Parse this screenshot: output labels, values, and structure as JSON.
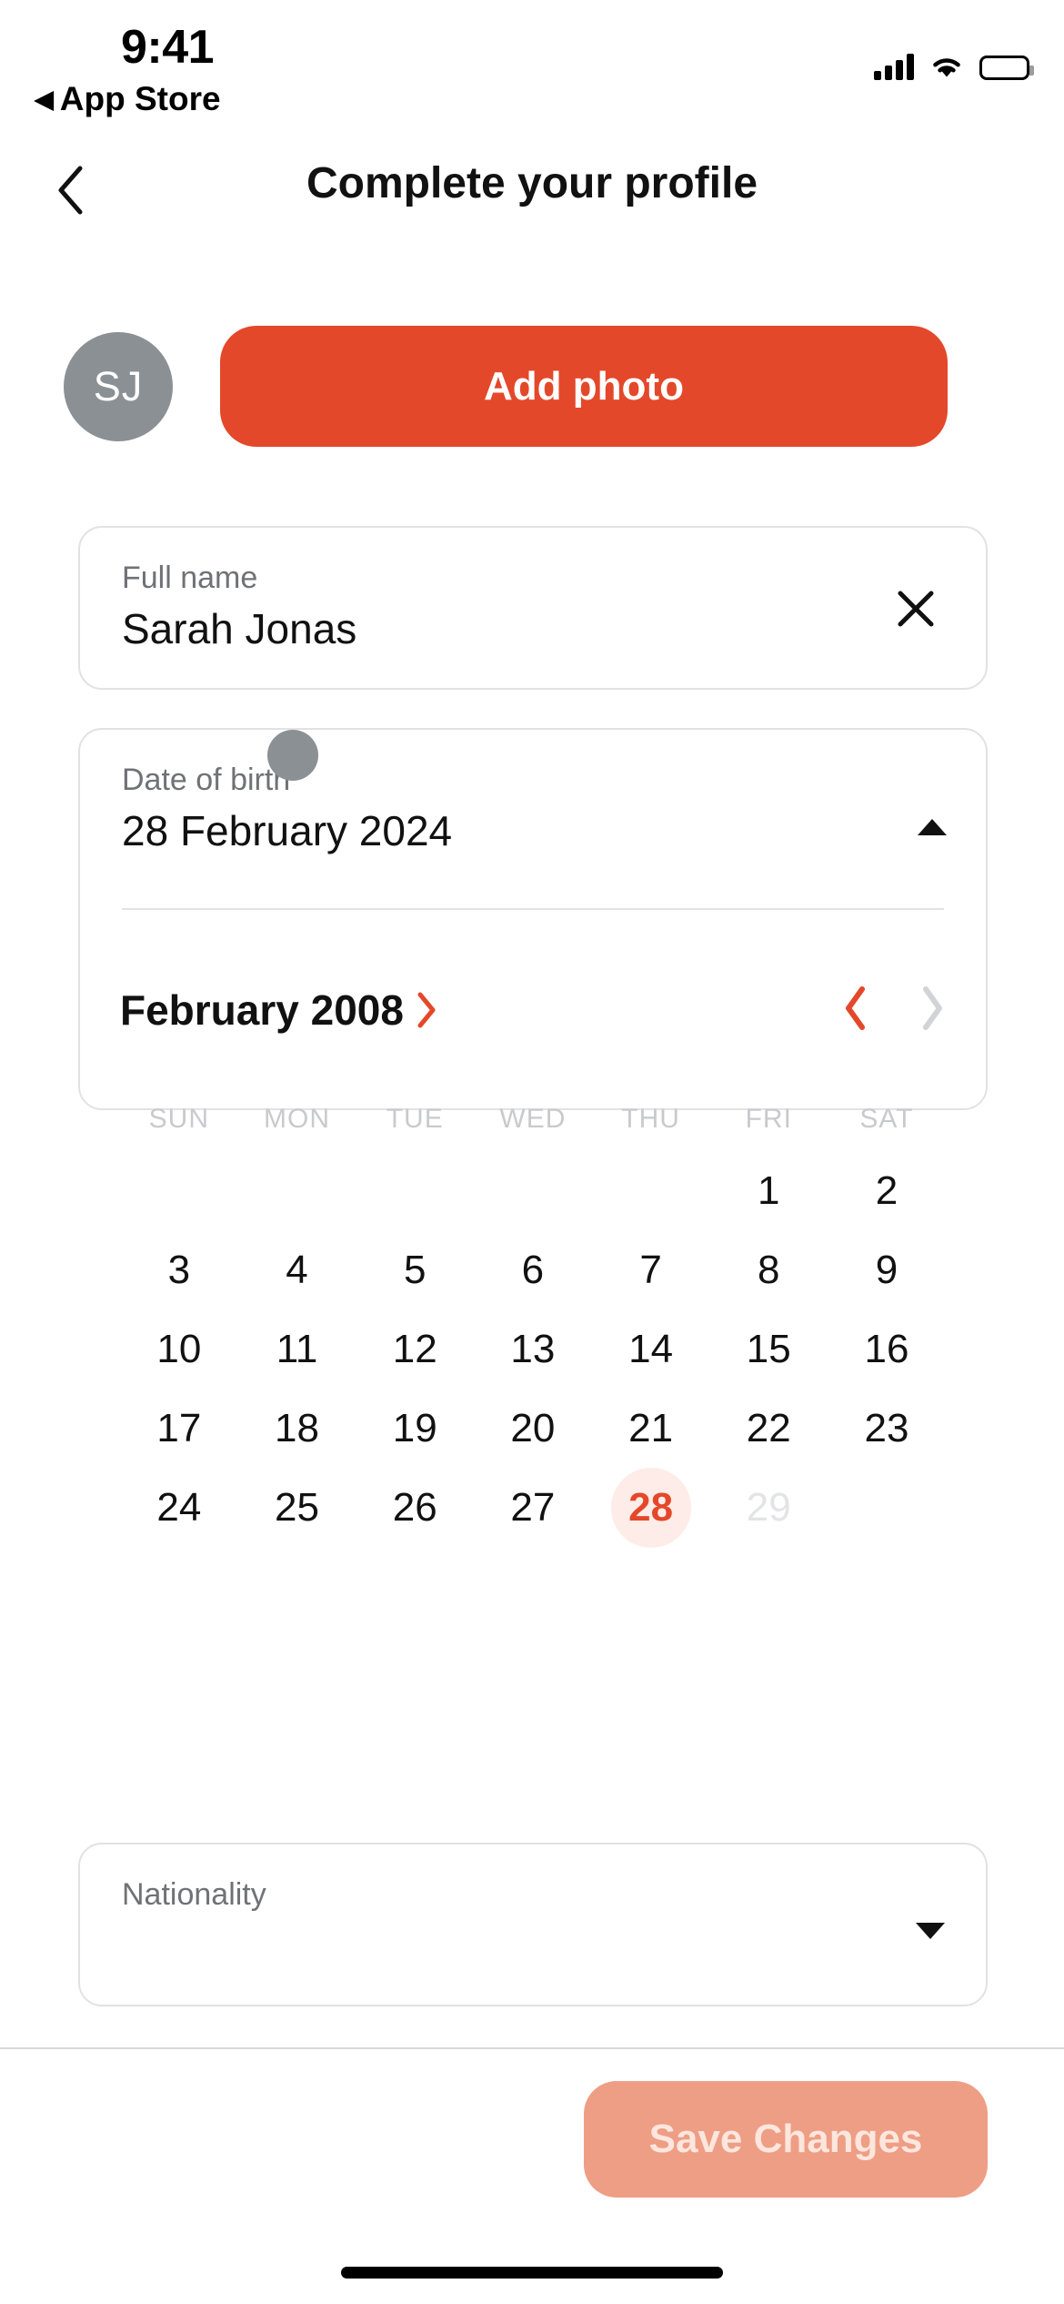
{
  "status_bar": {
    "time": "9:41",
    "back_label": "App Store",
    "back_icon": "triangle-left-icon",
    "signal_icon": "cellular-signal-icon",
    "signal_bars": 4,
    "wifi_icon": "wifi-icon",
    "battery_icon": "battery-full-icon",
    "battery_level_percent": 100
  },
  "header": {
    "back_icon": "chevron-left-icon",
    "title": "Complete your profile"
  },
  "profile": {
    "avatar_initials": "SJ",
    "avatar_color": "#8b9094",
    "add_photo_label": "Add photo",
    "accent_color": "#e4482a"
  },
  "fields": {
    "full_name": {
      "label": "Full name",
      "value": "Sarah Jonas",
      "clear_icon": "close-x-icon"
    },
    "date_of_birth": {
      "label": "Date of birth",
      "value": "28 February 2024",
      "expanded": true,
      "toggle_icon": "caret-up-icon"
    },
    "nationality": {
      "label": "Nationality",
      "value": "",
      "toggle_icon": "caret-down-icon"
    }
  },
  "calendar": {
    "month_label": "February 2008",
    "month_chevron_icon": "chevron-right-icon",
    "prev_icon": "chevron-left-icon",
    "next_icon": "chevron-right-icon",
    "prev_enabled": true,
    "next_enabled": false,
    "weekdays": [
      "SUN",
      "MON",
      "TUE",
      "WED",
      "THU",
      "FRI",
      "SAT"
    ],
    "selected_day": 28,
    "selected_color": "#e4482a",
    "selected_bg": "#fdece7",
    "disabled_days": [
      29
    ],
    "weeks": [
      [
        "",
        "",
        "",
        "",
        "",
        "1",
        "2"
      ],
      [
        "3",
        "4",
        "5",
        "6",
        "7",
        "8",
        "9"
      ],
      [
        "10",
        "11",
        "12",
        "13",
        "14",
        "15",
        "16"
      ],
      [
        "17",
        "18",
        "19",
        "20",
        "21",
        "22",
        "23"
      ],
      [
        "24",
        "25",
        "26",
        "27",
        "28",
        "29",
        ""
      ]
    ]
  },
  "footer": {
    "save_label": "Save Changes",
    "save_enabled": false,
    "save_color": "#ee9e85"
  }
}
